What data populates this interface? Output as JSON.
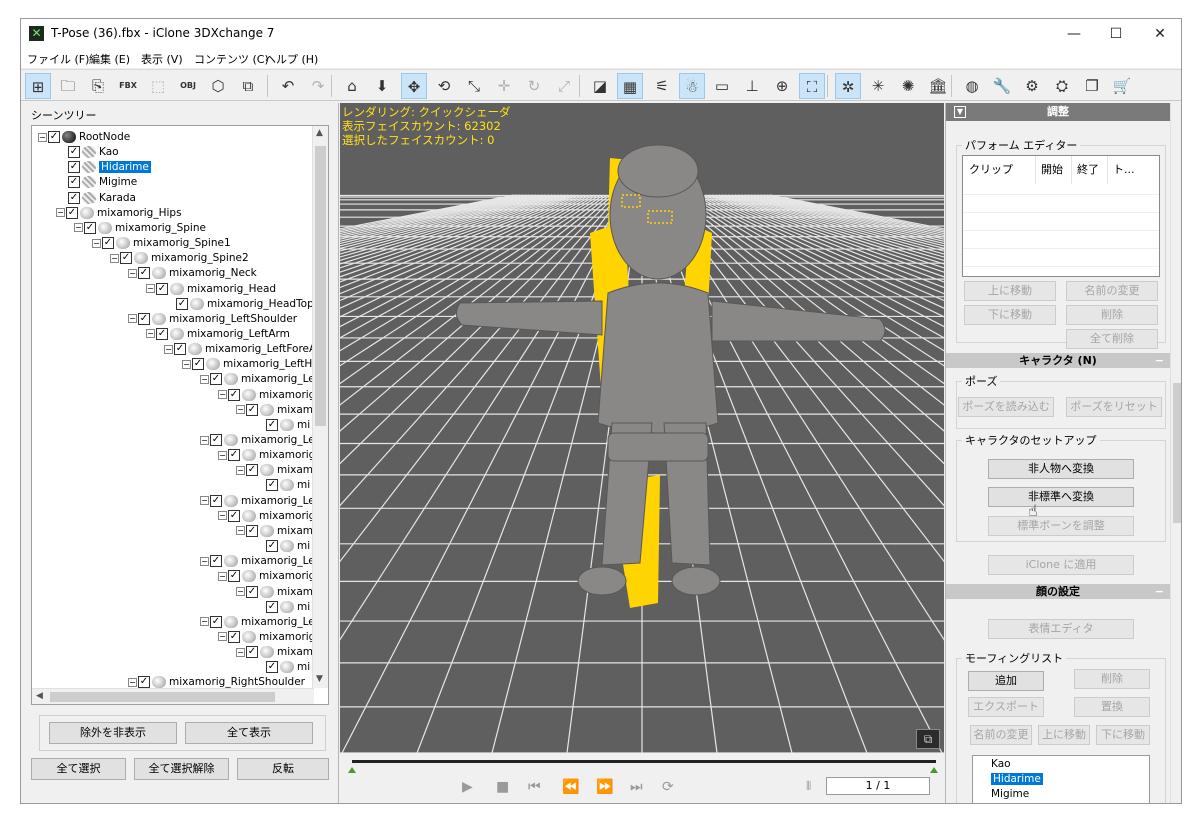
{
  "window": {
    "title": "T-Pose (36).fbx - iClone 3DXchange 7",
    "minimize": "—",
    "maximize": "☐",
    "close": "✕"
  },
  "menu": [
    "ファイル (F)",
    "編集 (E)",
    "表示 (V)",
    "コンテンツ (C)",
    "ヘルプ (H)"
  ],
  "toolbar": {
    "icons": [
      {
        "name": "scene-tree-icon",
        "glyph": "⊞"
      },
      {
        "name": "open-folder-icon",
        "glyph": "🗀"
      },
      {
        "name": "import-icon",
        "glyph": "⎘"
      },
      {
        "name": "export-fbx-icon",
        "glyph": "FBX"
      },
      {
        "name": "export-avatar-icon",
        "glyph": "⬚"
      },
      {
        "name": "export-obj-icon",
        "glyph": "OBJ"
      },
      {
        "name": "export-3d-icon",
        "glyph": "⬡"
      },
      {
        "name": "batch-icon",
        "glyph": "⧉"
      },
      {
        "name": "undo-icon",
        "glyph": "↶"
      },
      {
        "name": "redo-icon",
        "glyph": "↷"
      },
      {
        "name": "home-view-icon",
        "glyph": "⌂"
      },
      {
        "name": "move-down-icon",
        "glyph": "⬇"
      },
      {
        "name": "move-icon",
        "glyph": "✥"
      },
      {
        "name": "rotate-icon",
        "glyph": "⟲"
      },
      {
        "name": "scale-icon",
        "glyph": "⤡"
      },
      {
        "name": "pivot-icon",
        "glyph": "✛"
      },
      {
        "name": "reset-icon",
        "glyph": "↻"
      },
      {
        "name": "fit-icon",
        "glyph": "⤢"
      },
      {
        "name": "wireframe-icon",
        "glyph": "◪"
      },
      {
        "name": "grid-icon",
        "glyph": "▦"
      },
      {
        "name": "bone-icon",
        "glyph": "⚟"
      },
      {
        "name": "character-icon",
        "glyph": "☃"
      },
      {
        "name": "frame-icon",
        "glyph": "▭"
      },
      {
        "name": "floor-icon",
        "glyph": "⊥"
      },
      {
        "name": "globe-view-icon",
        "glyph": "⊕"
      },
      {
        "name": "focus-icon",
        "glyph": "⛶"
      },
      {
        "name": "light-icon",
        "glyph": "✲"
      },
      {
        "name": "spot-light-icon",
        "glyph": "✳"
      },
      {
        "name": "sun-icon",
        "glyph": "✺"
      },
      {
        "name": "museum-icon",
        "glyph": "🏛"
      },
      {
        "name": "world-icon",
        "glyph": "◍"
      },
      {
        "name": "wrench-icon",
        "glyph": "🔧"
      },
      {
        "name": "settings-icon",
        "glyph": "⚙"
      },
      {
        "name": "gear-icon",
        "glyph": "⛭"
      },
      {
        "name": "copy-icon",
        "glyph": "❐"
      },
      {
        "name": "cart-icon",
        "glyph": "🛒"
      }
    ]
  },
  "scene_tree": {
    "header": "シーンツリー",
    "nodes": [
      {
        "label": "RootNode",
        "level": 0,
        "icon": "black",
        "exp": "⊟"
      },
      {
        "label": "Kao",
        "level": 1,
        "icon": "mesh",
        "exp": ""
      },
      {
        "label": "Hidarime",
        "level": 1,
        "icon": "mesh",
        "exp": "",
        "selected": true
      },
      {
        "label": "Migime",
        "level": 1,
        "icon": "mesh",
        "exp": ""
      },
      {
        "label": "Karada",
        "level": 1,
        "icon": "mesh",
        "exp": ""
      },
      {
        "label": "mixamorig_Hips",
        "level": 1,
        "icon": "bone",
        "exp": "⊟"
      },
      {
        "label": "mixamorig_Spine",
        "level": 2,
        "icon": "bone",
        "exp": "⊟"
      },
      {
        "label": "mixamorig_Spine1",
        "level": 3,
        "icon": "bone",
        "exp": "⊟"
      },
      {
        "label": "mixamorig_Spine2",
        "level": 4,
        "icon": "bone",
        "exp": "⊟"
      },
      {
        "label": "mixamorig_Neck",
        "level": 5,
        "icon": "bone",
        "exp": "⊟"
      },
      {
        "label": "mixamorig_Head",
        "level": 6,
        "icon": "bone",
        "exp": "⊟"
      },
      {
        "label": "mixamorig_HeadTop_",
        "level": 7,
        "icon": "bone",
        "exp": ""
      },
      {
        "label": "mixamorig_LeftShoulder",
        "level": 5,
        "icon": "bone",
        "exp": "⊟"
      },
      {
        "label": "mixamorig_LeftArm",
        "level": 6,
        "icon": "bone",
        "exp": "⊟"
      },
      {
        "label": "mixamorig_LeftForeA",
        "level": 7,
        "icon": "bone",
        "exp": "⊟"
      },
      {
        "label": "mixamorig_LeftHa",
        "level": 8,
        "icon": "bone",
        "exp": "⊟"
      },
      {
        "label": "mixamorig_Le",
        "level": 9,
        "icon": "bone",
        "exp": "⊟"
      },
      {
        "label": "mixamorig",
        "level": 10,
        "icon": "bone",
        "exp": "⊟"
      },
      {
        "label": "mixam",
        "level": 11,
        "icon": "bone",
        "exp": "⊟"
      },
      {
        "label": "mi",
        "level": 12,
        "icon": "bone",
        "exp": ""
      },
      {
        "label": "mixamorig_Le",
        "level": 9,
        "icon": "bone",
        "exp": "⊟"
      },
      {
        "label": "mixamorig",
        "level": 10,
        "icon": "bone",
        "exp": "⊟"
      },
      {
        "label": "mixam",
        "level": 11,
        "icon": "bone",
        "exp": "⊟"
      },
      {
        "label": "mi",
        "level": 12,
        "icon": "bone",
        "exp": ""
      },
      {
        "label": "mixamorig_Le",
        "level": 9,
        "icon": "bone",
        "exp": "⊟"
      },
      {
        "label": "mixamorig",
        "level": 10,
        "icon": "bone",
        "exp": "⊟"
      },
      {
        "label": "mixam",
        "level": 11,
        "icon": "bone",
        "exp": "⊟"
      },
      {
        "label": "mi",
        "level": 12,
        "icon": "bone",
        "exp": ""
      },
      {
        "label": "mixamorig_Le",
        "level": 9,
        "icon": "bone",
        "exp": "⊟"
      },
      {
        "label": "mixamorig",
        "level": 10,
        "icon": "bone",
        "exp": "⊟"
      },
      {
        "label": "mixam",
        "level": 11,
        "icon": "bone",
        "exp": "⊟"
      },
      {
        "label": "mi",
        "level": 12,
        "icon": "bone",
        "exp": ""
      },
      {
        "label": "mixamorig_Le",
        "level": 9,
        "icon": "bone",
        "exp": "⊟"
      },
      {
        "label": "mixamorig",
        "level": 10,
        "icon": "bone",
        "exp": "⊟"
      },
      {
        "label": "mixam",
        "level": 11,
        "icon": "bone",
        "exp": "⊟"
      },
      {
        "label": "mi",
        "level": 12,
        "icon": "bone",
        "exp": ""
      },
      {
        "label": "mixamorig_RightShoulder",
        "level": 5,
        "icon": "bone",
        "exp": "⊟"
      }
    ],
    "buttons": {
      "hide_unselected": "除外を非表示",
      "show_all": "全て表示",
      "select_all": "全て選択",
      "deselect_all": "全て選択解除",
      "invert": "反転"
    }
  },
  "viewport": {
    "info_lines": [
      "レンダリング: クイックシェーダ",
      "表示フェイスカウント: 62302",
      "選択したフェイスカウント: 0"
    ],
    "colors": {
      "background": "#5f5f5f",
      "grid": "#e6e6e6",
      "highlight": "#ffd400",
      "figure": "#8a8886"
    }
  },
  "timeline": {
    "frame_display": "1 / 1",
    "controls": [
      {
        "name": "play-icon",
        "glyph": "▶"
      },
      {
        "name": "stop-icon",
        "glyph": "■"
      },
      {
        "name": "first-frame-icon",
        "glyph": "⏮"
      },
      {
        "name": "rewind-icon",
        "glyph": "⏪"
      },
      {
        "name": "fast-forward-icon",
        "glyph": "⏩"
      },
      {
        "name": "last-frame-icon",
        "glyph": "⏭"
      },
      {
        "name": "loop-icon",
        "glyph": "⟳"
      }
    ]
  },
  "adjust_panel": {
    "header": "調整",
    "perform_editor": {
      "title": "パフォーム エディター",
      "columns": [
        "クリップ",
        "開始",
        "終了",
        "ト..."
      ],
      "buttons": {
        "move_up": "上に移動",
        "rename": "名前の変更",
        "move_down": "下に移動",
        "delete": "削除",
        "delete_all": "全て削除"
      }
    },
    "character": {
      "header": "キャラクタ (N)",
      "pose_group": "ポーズ",
      "load_pose": "ポーズを読み込む",
      "reset_pose": "ポーズをリセット",
      "setup_group": "キャラクタのセットアップ",
      "to_non_human": "非人物へ変換",
      "to_non_standard": "非標準へ変換",
      "adjust_bones": "標準ボーンを調整",
      "apply_iclone": "iClone に適用"
    },
    "face": {
      "header": "顔の設定",
      "expression_editor": "表情エディタ",
      "morph_group": "モーフィングリスト",
      "add": "追加",
      "delete": "削除",
      "export": "エクスポート",
      "replace": "置換",
      "rename": "名前の変更",
      "move_up": "上に移動",
      "move_down": "下に移動",
      "list": [
        "Kao",
        "Hidarime",
        "Migime"
      ]
    }
  }
}
